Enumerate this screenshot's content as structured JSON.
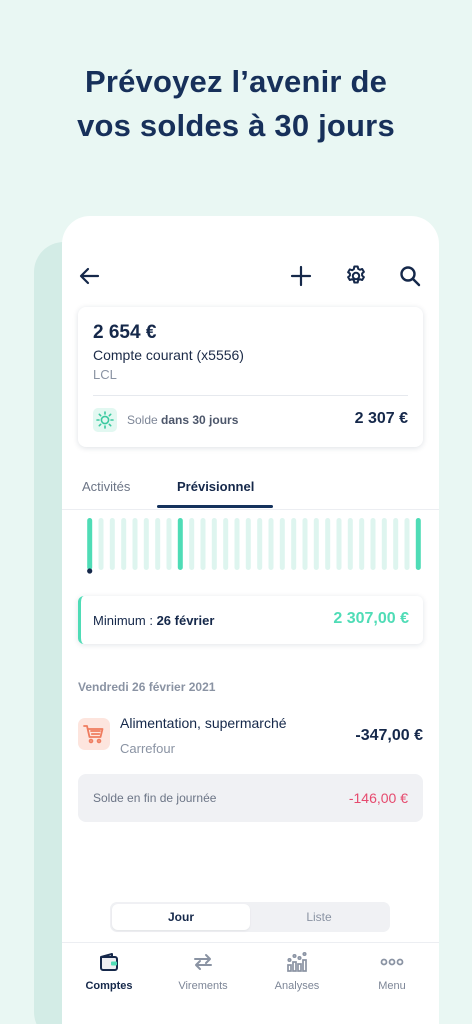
{
  "headline": {
    "line1": "Prévoyez l’avenir de",
    "line2": "vos soldes à 30 jours"
  },
  "toolbar": {
    "back_icon": "arrow-left-icon",
    "add_icon": "plus-icon",
    "settings_icon": "gear-icon",
    "search_icon": "search-icon"
  },
  "account": {
    "balance": "2 654 €",
    "name": "Compte courant (x5556)",
    "bank": "LCL",
    "forecast_prefix": "Solde ",
    "forecast_bold": "dans 30 jours",
    "forecast_value": "2 307 €"
  },
  "tabs": [
    {
      "label": "Activités",
      "active": false
    },
    {
      "label": "Prévisionnel",
      "active": true
    }
  ],
  "chart_data": {
    "type": "bar",
    "days": 30,
    "highlighted_days": [
      1,
      9,
      30
    ],
    "current_day": 1,
    "colors": {
      "base": "#def5ef",
      "highlight": "#4fdcb6",
      "marker": "#15284a"
    }
  },
  "minimum": {
    "label": "Minimum : ",
    "date": "26 février",
    "value": "2 307,00 €"
  },
  "day_section": {
    "date": "Vendredi 26 février 2021",
    "transaction": {
      "category": "Alimentation, supermarché",
      "merchant": "Carrefour",
      "amount": "-347,00 €",
      "icon": "shopping-cart-icon"
    },
    "end_of_day_label": "Solde en fin de journée",
    "end_of_day_value": "-146,00 €"
  },
  "view_toggle": {
    "day": "Jour",
    "list": "Liste",
    "selected": "Jour"
  },
  "bottom_nav": [
    {
      "label": "Comptes",
      "icon": "wallet-icon",
      "active": true
    },
    {
      "label": "Virements",
      "icon": "transfer-arrows-icon",
      "active": false
    },
    {
      "label": "Analyses",
      "icon": "analytics-chart-icon",
      "active": false
    },
    {
      "label": "Menu",
      "icon": "more-dots-icon",
      "active": false
    }
  ],
  "colors": {
    "background": "#e9f7f3",
    "primary": "#15284a",
    "accent": "#4fdcb6",
    "negative": "#e64a6e"
  }
}
